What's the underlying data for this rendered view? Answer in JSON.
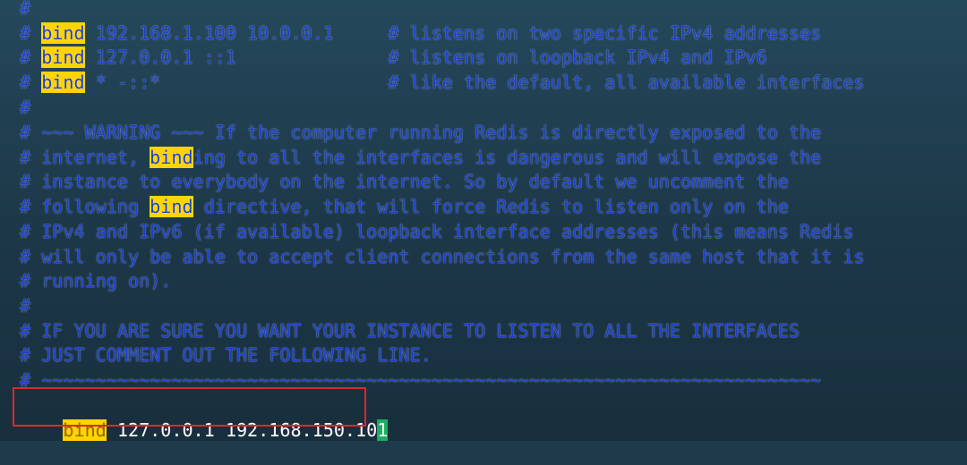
{
  "lines": [
    [
      "#"
    ],
    [
      "# ",
      "bind",
      " 192.168.1.100 10.0.0.1     # listens on two specific IPv4 addresses"
    ],
    [
      "# ",
      "bind",
      " 127.0.0.1 ::1              # listens on loopback IPv4 and IPv6"
    ],
    [
      "# ",
      "bind",
      " * -::*                     # like the default, all available interfaces"
    ],
    [
      "#"
    ],
    [
      "# ~~~ WARNING ~~~ If the computer running Redis is directly exposed to the"
    ],
    [
      "# internet, ",
      "bind",
      "ing to all the interfaces is dangerous and will expose the"
    ],
    [
      "# instance to everybody on the internet. So by default we uncomment the"
    ],
    [
      "# following ",
      "bind",
      " directive, that will force Redis to listen only on the"
    ],
    [
      "# IPv4 and IPv6 (if available) loopback interface addresses (this means Redis"
    ],
    [
      "# will only be able to accept client connections from the same host that it is"
    ],
    [
      "# running on)."
    ],
    [
      "#"
    ],
    [
      "# IF YOU ARE SURE YOU WANT YOUR INSTANCE TO LISTEN TO ALL THE INTERFACES"
    ],
    [
      "# JUST COMMENT OUT THE FOLLOWING LINE."
    ],
    [
      "# ~~~~~~~~~~~~~~~~~~~~~~~~~~~~~~~~~~~~~~~~~~~~~~~~~~~~~~~~~~~~~~~~~~~~~~~~"
    ]
  ],
  "active_line": {
    "keyword": "bind",
    "value": " 127.0.0.1 192.168.150.10",
    "cursor_char": "1"
  },
  "colors": {
    "comment": "#1a3fd0",
    "highlight": "#ffd400",
    "cursor": "#18b060",
    "annotation_box": "#e02828"
  }
}
